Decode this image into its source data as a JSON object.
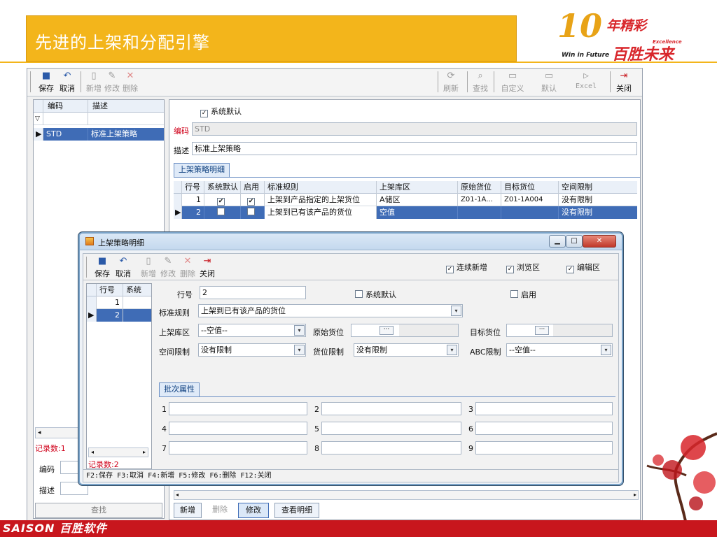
{
  "slide": {
    "title": "先进的上架和分配引擎",
    "logo_num": "10",
    "logo_cn1": "年精彩",
    "logo_en1": "Excellence",
    "logo_en2": "Win in Future",
    "logo_cn2": "百胜未来",
    "brand": "SAISON 百胜软件"
  },
  "toolbar": {
    "save": "保存",
    "cancel": "取消",
    "add": "新增",
    "edit": "修改",
    "delete": "删除",
    "refresh": "刷新",
    "find": "查找",
    "custom": "自定义",
    "default": "默认",
    "excel": "Excel",
    "close": "关闭"
  },
  "left_list": {
    "columns": [
      "编码",
      "描述"
    ],
    "filter_icon": "filter-icon",
    "rows": [
      {
        "code": "STD",
        "desc": "标准上架策略"
      }
    ],
    "record_count": "记录数:1",
    "code_label": "编码",
    "desc_label": "描述",
    "search_button": "查找"
  },
  "detail": {
    "system_default_label": "系统默认",
    "code_label": "编码",
    "code_value": "STD",
    "desc_label": "描述",
    "desc_value": "标准上架策略",
    "tab_detail": "上架策略明细",
    "columns": [
      "行号",
      "系统默认",
      "启用",
      "标准规则",
      "上架库区",
      "原始货位",
      "目标货位",
      "空间限制"
    ],
    "rows": [
      {
        "no": "1",
        "sys_default": "✔",
        "enabled": "✔",
        "rule": "上架到产品指定的上架货位",
        "zone": "A储区",
        "src": "Z01-1A...",
        "dst": "Z01-1A004",
        "space": "没有限制"
      },
      {
        "no": "2",
        "sys_default": "",
        "enabled": "",
        "rule": "上架到已有该产品的货位",
        "zone": "空值",
        "src": "",
        "dst": "",
        "space": "没有限制"
      }
    ],
    "bottom_buttons": {
      "add": "新增",
      "delete": "删除",
      "edit": "修改",
      "view": "查看明细"
    }
  },
  "dialog": {
    "title": "上架策略明细",
    "toolbar": {
      "save": "保存",
      "cancel": "取消",
      "add": "新增",
      "edit": "修改",
      "delete": "删除",
      "close": "关闭"
    },
    "continuous_add": "连续新增",
    "browse_area": "浏览区",
    "edit_area": "编辑区",
    "left_columns": [
      "行号",
      "系统"
    ],
    "left_rows": [
      "1",
      "2"
    ],
    "record_count": "记录数:2",
    "row_no_label": "行号",
    "row_no_value": "2",
    "sys_default_label": "系统默认",
    "enabled_label": "启用",
    "rule_label": "标准规则",
    "rule_value": "上架到已有该产品的货位",
    "zone_label": "上架库区",
    "zone_value": "--空值--",
    "src_loc_label": "原始货位",
    "dst_loc_label": "目标货位",
    "space_label": "空间限制",
    "space_value": "没有限制",
    "loc_limit_label": "货位限制",
    "loc_limit_value": "没有限制",
    "abc_label": "ABC限制",
    "abc_value": "--空值--",
    "batch_tab": "批次属性",
    "batch_nums": [
      "1",
      "2",
      "3",
      "4",
      "5",
      "6",
      "7",
      "8",
      "9"
    ],
    "status_bar": "F2:保存  F3:取消  F4:新增  F5:修改  F6:删除  F12:关闭"
  }
}
